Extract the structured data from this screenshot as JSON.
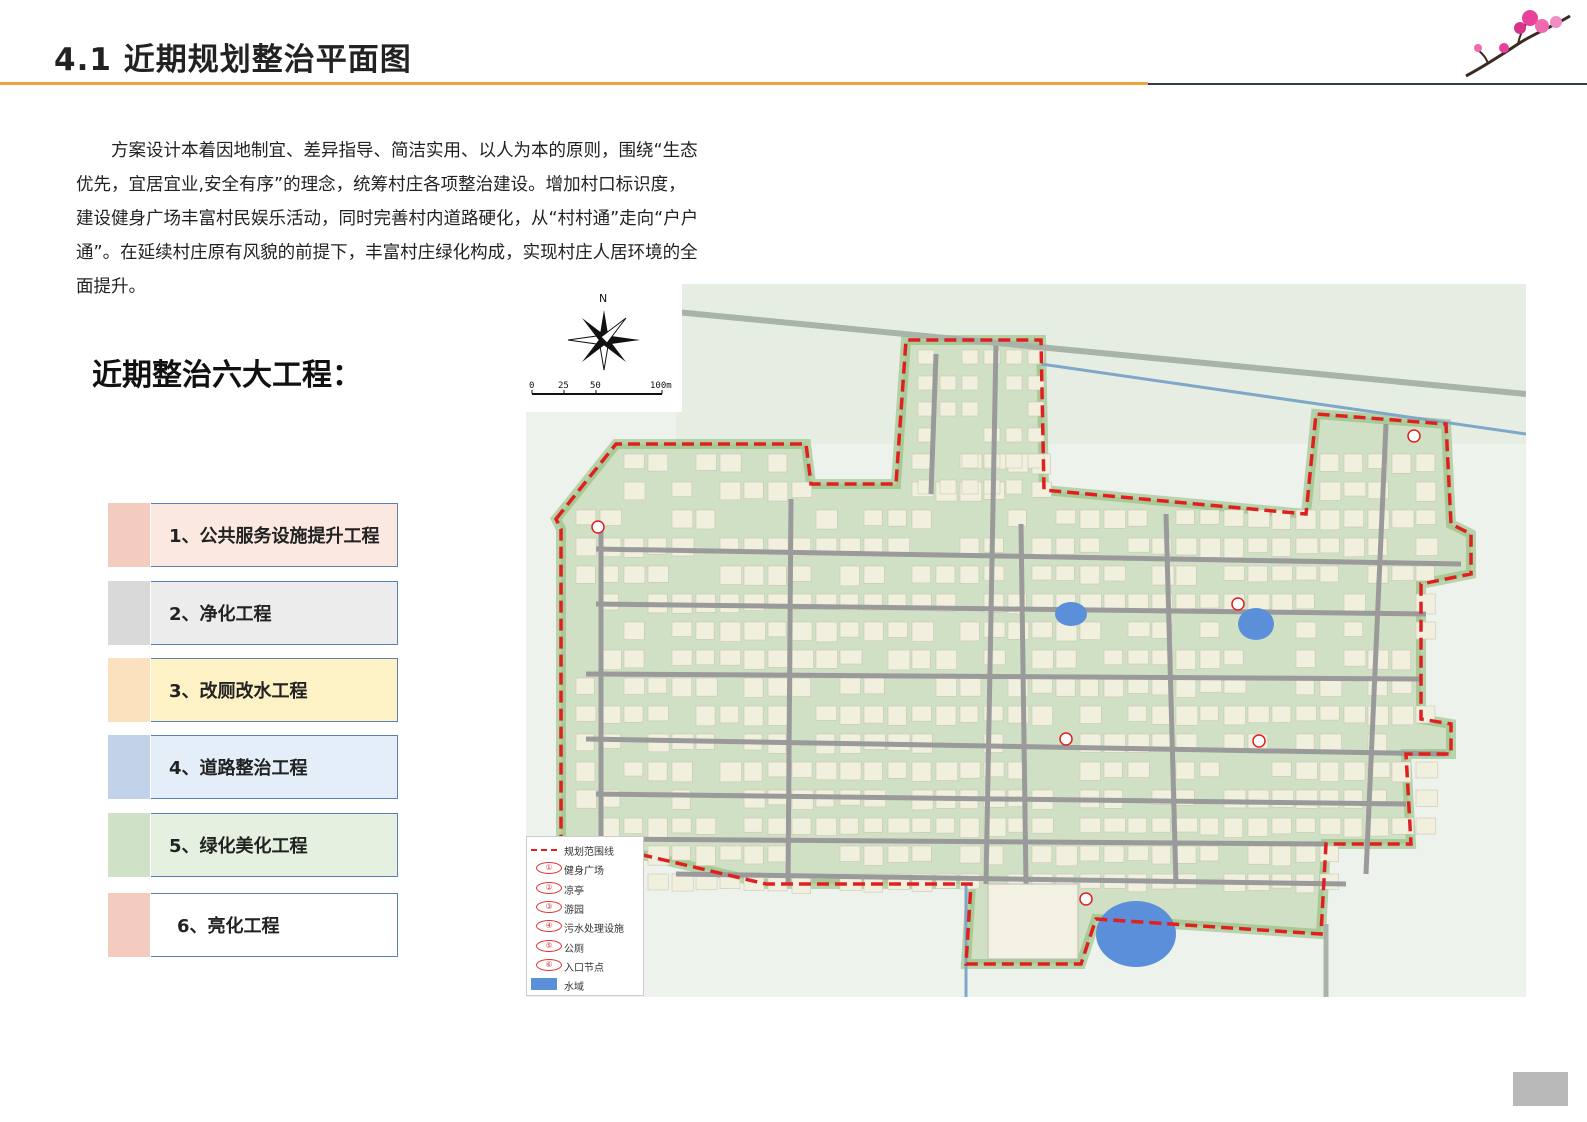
{
  "header": {
    "title": "4.1 近期规划整治平面图"
  },
  "intro": {
    "text": "方案设计本着因地制宜、差异指导、简洁实用、以人为本的原则，围绕“生态优先，宜居宜业,安全有序”的理念，统筹村庄各项整治建设。增加村口标识度，建设健身广场丰富村民娱乐活动，同时完善村内道路硬化，从“村村通”走向“户户通”。在延续村庄原有风貌的前提下，丰富村庄绿化构成，实现村庄人居环境的全面提升。"
  },
  "projects": {
    "heading": "近期整治六大工程：",
    "items": [
      {
        "label": "1、公共服务设施提升工程",
        "color": "#f4cbbf",
        "bg": "#fbe9e1"
      },
      {
        "label": "2、净化工程",
        "color": "#d9d9d9",
        "bg": "#ececec"
      },
      {
        "label": "3、改厕改水工程",
        "color": "#fbe1be",
        "bg": "#fdf2c6"
      },
      {
        "label": "4、道路整治工程",
        "color": "#c1d2e9",
        "bg": "#e4eef8"
      },
      {
        "label": "5、绿化美化工程",
        "color": "#cfe2c8",
        "bg": "#e5f0e0"
      },
      {
        "label": "6、亮化工程",
        "color": "#f4cbbf",
        "bg": "#ffffff"
      }
    ]
  },
  "map": {
    "north_label": "N",
    "scale_labels": [
      "0",
      "25",
      "50",
      "100m"
    ],
    "legend": [
      {
        "type": "boundary",
        "label": "规划范围线"
      },
      {
        "type": "number",
        "num": "①",
        "label": "健身广场"
      },
      {
        "type": "number",
        "num": "②",
        "label": "凉亭"
      },
      {
        "type": "number",
        "num": "③",
        "label": "游园"
      },
      {
        "type": "number",
        "num": "④",
        "label": "污水处理设施"
      },
      {
        "type": "number",
        "num": "⑤",
        "label": "公厕"
      },
      {
        "type": "number",
        "num": "⑥",
        "label": "入口节点"
      },
      {
        "type": "water",
        "label": "水域"
      }
    ],
    "colors": {
      "boundary": "#e02020",
      "water": "#5b8fd9",
      "green": "#7fb36a",
      "road": "#9a9a9a",
      "building": "#f1f0df"
    }
  }
}
